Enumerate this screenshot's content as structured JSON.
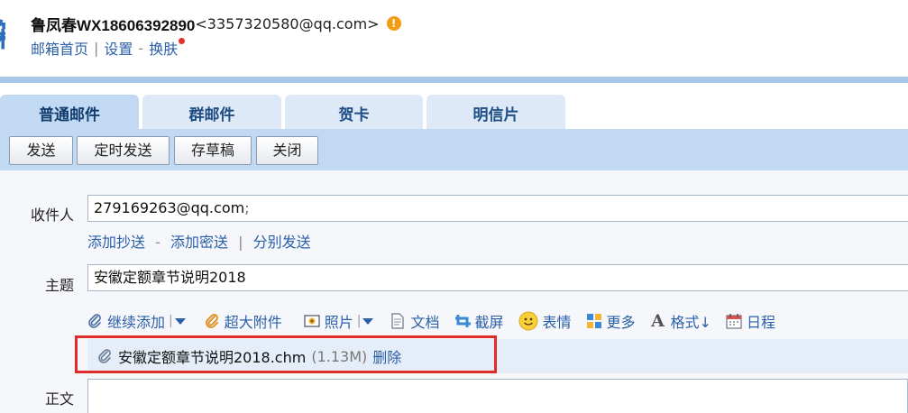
{
  "header": {
    "logo_fragment": "箱",
    "account_name": "鲁凤春WX18606392890",
    "account_email": "<3357320580@qq.com>",
    "warning_glyph": "!",
    "links": [
      "邮箱首页",
      "设置",
      "换肤"
    ]
  },
  "tabs": [
    {
      "label": "普通邮件",
      "active": true
    },
    {
      "label": "群邮件"
    },
    {
      "label": "贺卡"
    },
    {
      "label": "明信片"
    }
  ],
  "toolbar": {
    "send": "发送",
    "scheduled_send": "定时发送",
    "save_draft": "存草稿",
    "close": "关闭"
  },
  "compose": {
    "recipient_label": "收件人",
    "recipient_value": "279169263@qq.com",
    "recipient_separator": ";",
    "cc_link": "添加抄送",
    "bcc_link": "添加密送",
    "separate_link": "分别发送",
    "subject_label": "主题",
    "subject_value": "安徽定额章节说明2018",
    "body_label": "正文"
  },
  "attach_tools": [
    {
      "name": "continue-attach",
      "label": "继续添加",
      "icon": "paperclip-icon",
      "dropdown": true
    },
    {
      "name": "large-attach",
      "label": "超大附件",
      "icon": "large-paperclip-icon"
    },
    {
      "name": "photo",
      "label": "照片",
      "icon": "photo-icon",
      "dropdown": true
    },
    {
      "name": "document",
      "label": "文档",
      "icon": "document-icon"
    },
    {
      "name": "screenshot",
      "label": "截屏",
      "icon": "scissors-icon"
    },
    {
      "name": "emoji",
      "label": "表情",
      "icon": "smiley-icon"
    },
    {
      "name": "more",
      "label": "更多",
      "icon": "grid-icon"
    },
    {
      "name": "format",
      "label": "格式↓",
      "icon": "font-icon"
    },
    {
      "name": "schedule",
      "label": "日程",
      "icon": "calendar-icon"
    }
  ],
  "attachment": {
    "filename": "安徽定额章节说明2018.chm",
    "size": "(1.13M)",
    "delete_label": "删除"
  },
  "colors": {
    "accent_blue": "#2b5fa8",
    "highlight_red": "#e02b2b",
    "warning_orange": "#f39c12"
  }
}
